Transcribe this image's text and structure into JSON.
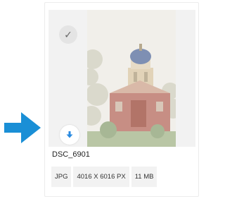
{
  "arrow_color": "#1a8fd6",
  "accent_color": "#2a8ae0",
  "file": {
    "name": "DSC_6901",
    "format": "JPG",
    "dimensions": "4016 X 6016 PX",
    "size": "11 MB"
  },
  "icons": {
    "select": "checkmark-icon",
    "download": "download-arrow-icon",
    "pointer": "right-arrow-icon"
  }
}
